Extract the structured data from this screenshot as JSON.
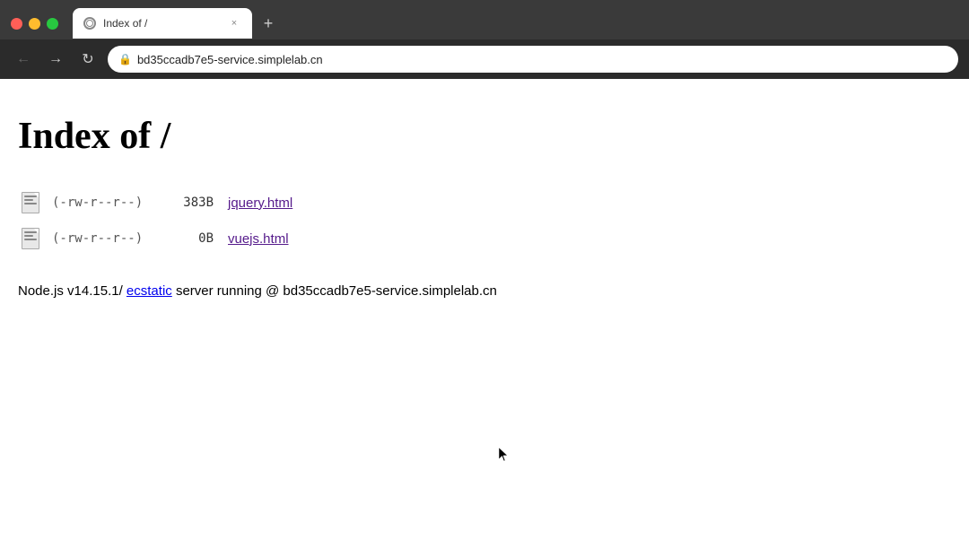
{
  "browser": {
    "tab_title": "Index of /",
    "url": "bd35ccadb7e5-service.simplelab.cn",
    "new_tab_label": "+",
    "close_label": "×",
    "back_label": "←",
    "forward_label": "→",
    "reload_label": "↻"
  },
  "page": {
    "heading": "Index of /",
    "files": [
      {
        "perms": "(-rw-r--r--)",
        "size": "383B",
        "name": "jquery.html"
      },
      {
        "perms": "(-rw-r--r--)",
        "size": "0B",
        "name": "vuejs.html"
      }
    ],
    "footer_prefix": "Node.js v14.15.1/ ",
    "footer_link": "ecstatic",
    "footer_suffix": " server running @ bd35ccadb7e5-service.simplelab.cn"
  }
}
